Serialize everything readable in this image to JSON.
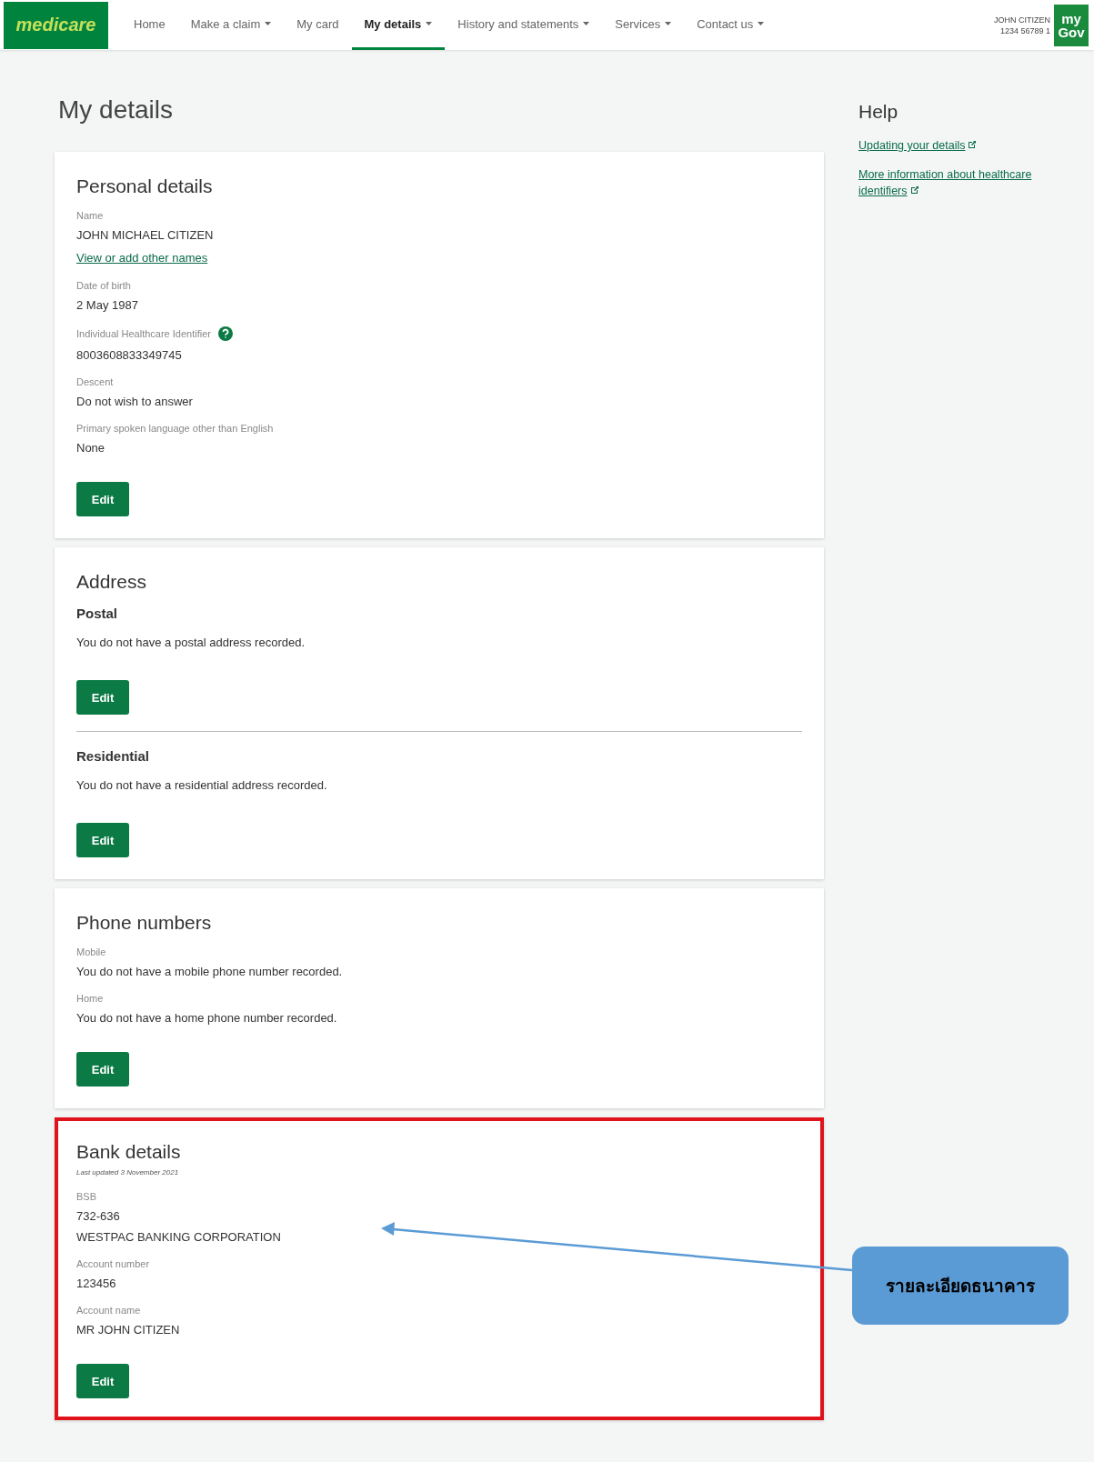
{
  "header": {
    "logo": "medicare",
    "nav": [
      {
        "label": "Home",
        "dropdown": false,
        "selected": false
      },
      {
        "label": "Make a claim",
        "dropdown": true,
        "selected": false
      },
      {
        "label": "My card",
        "dropdown": false,
        "selected": false
      },
      {
        "label": "My details",
        "dropdown": true,
        "selected": true
      },
      {
        "label": "History and statements",
        "dropdown": true,
        "selected": false
      },
      {
        "label": "Services",
        "dropdown": true,
        "selected": false
      },
      {
        "label": "Contact us",
        "dropdown": true,
        "selected": false
      }
    ],
    "user": {
      "name": "JOHN CITIZEN",
      "number": "1234 56789 1"
    },
    "mygov": {
      "top": "my",
      "bottom": "Gov"
    }
  },
  "page_title": "My details",
  "cards": [
    {
      "title": "Personal details",
      "highlighted": false,
      "sections": [
        {
          "fields": [
            {
              "label": "Name",
              "values": [
                "JOHN MICHAEL CITIZEN"
              ],
              "link": "View or add other names",
              "help": false
            },
            {
              "label": "Date of birth",
              "values": [
                "2 May 1987"
              ],
              "help": false
            },
            {
              "label": "Individual Healthcare Identifier",
              "values": [
                "8003608833349745"
              ],
              "help": true
            },
            {
              "label": "Descent",
              "values": [
                "Do not wish to answer"
              ],
              "help": false
            },
            {
              "label": "Primary spoken language other than English",
              "values": [
                "None"
              ],
              "help": false
            }
          ],
          "button": "Edit"
        }
      ]
    },
    {
      "title": "Address",
      "highlighted": false,
      "sections": [
        {
          "heading": "Postal",
          "text": "You do not have a postal address recorded.",
          "button": "Edit"
        },
        {
          "heading": "Residential",
          "text": "You do not have a residential address recorded.",
          "button": "Edit"
        }
      ]
    },
    {
      "title": "Phone numbers",
      "highlighted": false,
      "sections": [
        {
          "fields": [
            {
              "label": "Mobile",
              "values": [
                "You do not have a mobile phone number recorded."
              ],
              "help": false
            },
            {
              "label": "Home",
              "values": [
                "You do not have a home phone number recorded."
              ],
              "help": false
            }
          ],
          "button": "Edit"
        }
      ]
    },
    {
      "title": "Bank details",
      "subtitle": "Last updated 3 November 2021",
      "highlighted": true,
      "sections": [
        {
          "fields": [
            {
              "label": "BSB",
              "values": [
                "732-636",
                "WESTPAC BANKING CORPORATION"
              ],
              "help": false
            },
            {
              "label": "Account number",
              "values": [
                "123456"
              ],
              "help": false
            },
            {
              "label": "Account name",
              "values": [
                "MR JOHN CITIZEN"
              ],
              "help": false
            }
          ],
          "button": "Edit"
        }
      ]
    }
  ],
  "help": {
    "title": "Help",
    "links": [
      "Updating your details",
      "More information about healthcare identifiers"
    ]
  },
  "annotation": {
    "text": "รายละเอียดธนาคาร"
  }
}
